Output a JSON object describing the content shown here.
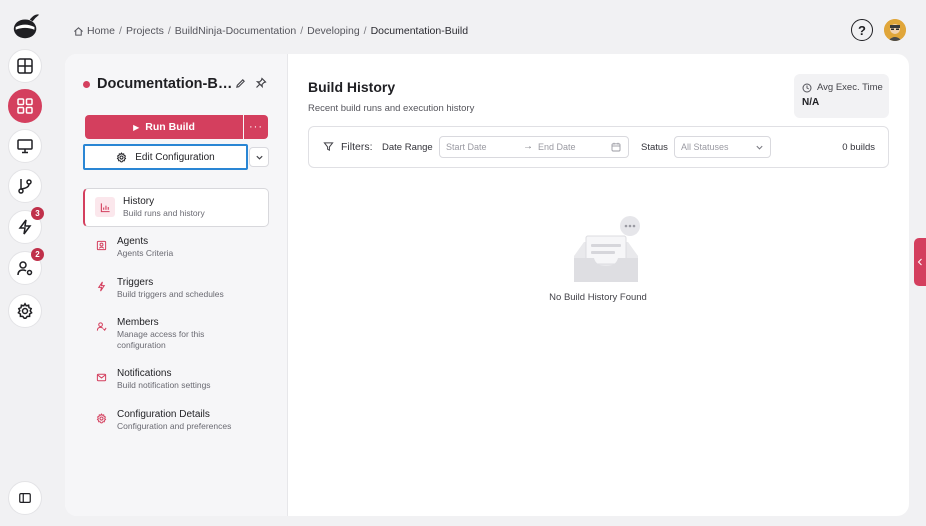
{
  "breadcrumb": [
    "Home",
    "Projects",
    "BuildNinja-Documentation",
    "Developing",
    "Documentation-Build"
  ],
  "rail": {
    "badges": {
      "triggers": "3",
      "members": "2"
    }
  },
  "header": {
    "help": "?"
  },
  "config": {
    "title": "Documentation-Build",
    "run_build": "Run Build",
    "more": "···",
    "edit_configuration": "Edit Configuration"
  },
  "nav": [
    {
      "label": "History",
      "desc": "Build runs and history"
    },
    {
      "label": "Agents",
      "desc": "Agents Criteria"
    },
    {
      "label": "Triggers",
      "desc": "Build triggers and schedules"
    },
    {
      "label": "Members",
      "desc": "Manage access for this configuration"
    },
    {
      "label": "Notifications",
      "desc": "Build notification settings"
    },
    {
      "label": "Configuration Details",
      "desc": "Configuration and preferences"
    }
  ],
  "history": {
    "title": "Build History",
    "subtitle": "Recent build runs and execution history",
    "avg_label": "Avg Exec. Time",
    "avg_value": "N/A",
    "filters_label": "Filters:",
    "date_range_label": "Date Range",
    "start_placeholder": "Start Date",
    "arrow": "→",
    "end_placeholder": "End Date",
    "status_label": "Status",
    "status_value": "All Statuses",
    "builds_count": "0 builds",
    "empty_text": "No Build History Found"
  },
  "colors": {
    "accent": "#d43f5e",
    "focus": "#2a86d4"
  }
}
